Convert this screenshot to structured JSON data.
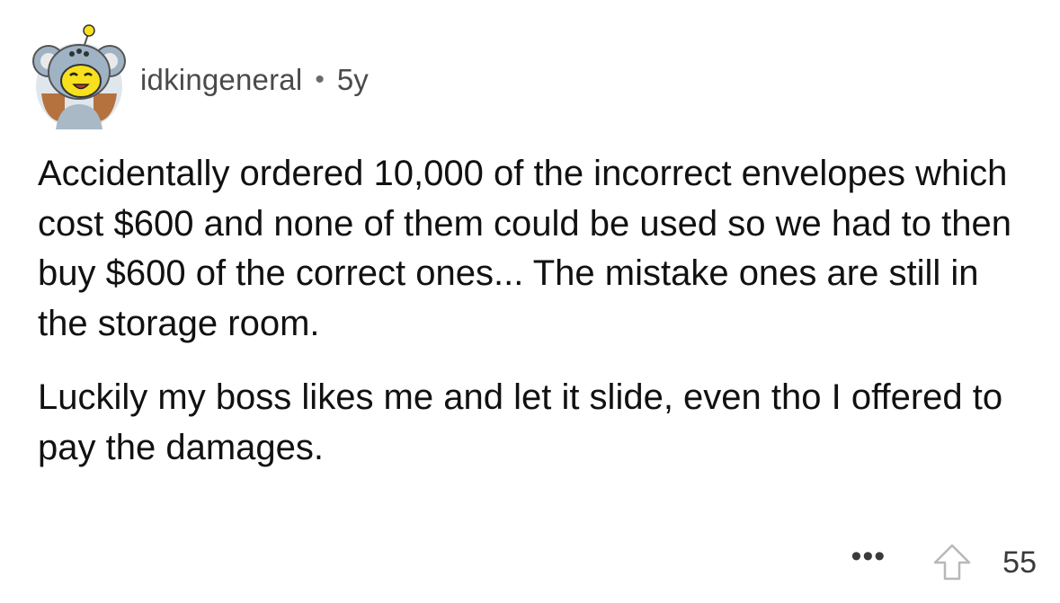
{
  "comment": {
    "author": "idkingeneral",
    "separator": "•",
    "age": "5y",
    "paragraphs": [
      "Accidentally ordered 10,000 of the incorrect envelopes which cost $600 and none of them could be used so we had to then buy $600 of the correct ones... The mistake ones are still in the storage room.",
      "Luckily my boss likes me and let it slide, even tho I offered to pay the damages."
    ],
    "more_label": "•••",
    "score": "55"
  },
  "icons": {
    "avatar": "koala-avatar-icon",
    "more": "more-options-icon",
    "upvote": "upvote-arrow-icon"
  },
  "colors": {
    "text": "#111111",
    "meta": "#4a4a4b",
    "avatar_fur": "#9fb3c4",
    "avatar_face": "#f7e01d",
    "avatar_bg": "#dfe7ec"
  }
}
